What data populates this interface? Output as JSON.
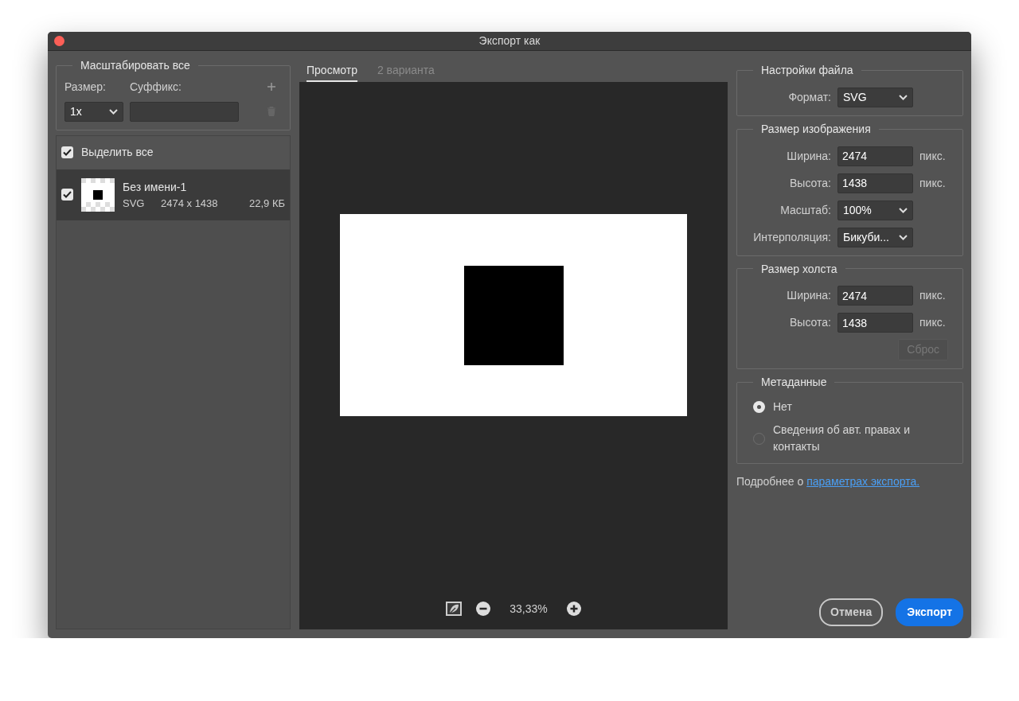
{
  "window": {
    "title": "Экспорт как"
  },
  "scale_all": {
    "title": "Масштабировать все",
    "size_label": "Размер:",
    "suffix_label": "Суффикс:",
    "size_value": "1x"
  },
  "select_all": {
    "label": "Выделить все",
    "checked": true
  },
  "assets": [
    {
      "name": "Без имени-1",
      "format": "SVG",
      "dimensions": "2474 x 1438",
      "file_size": "22,9 КБ",
      "checked": true,
      "selected": true
    }
  ],
  "tabs": [
    {
      "label": "Просмотр",
      "selected": true
    },
    {
      "label": "2 варианта",
      "selected": false
    }
  ],
  "zoom": {
    "reading": "33,33%"
  },
  "file_settings": {
    "title": "Настройки файла",
    "fields": [
      {
        "kind": "select",
        "label": "Формат:",
        "value": "SVG"
      }
    ]
  },
  "image_size": {
    "title": "Размер изображения",
    "fields": [
      {
        "kind": "input",
        "label": "Ширина:",
        "value": "2474",
        "unit": "пикс."
      },
      {
        "kind": "input",
        "label": "Высота:",
        "value": "1438",
        "unit": "пикс."
      },
      {
        "kind": "select",
        "label": "Масштаб:",
        "value": "100%"
      },
      {
        "kind": "select",
        "label": "Интерполяция:",
        "value": "Бикуби..."
      }
    ]
  },
  "canvas_size": {
    "title": "Размер холста",
    "fields": [
      {
        "kind": "input",
        "label": "Ширина:",
        "value": "2474",
        "unit": "пикс."
      },
      {
        "kind": "input",
        "label": "Высота:",
        "value": "1438",
        "unit": "пикс."
      }
    ],
    "reset_button": {
      "label": "Сброс",
      "disabled": true
    }
  },
  "metadata": {
    "title": "Метаданные",
    "options": [
      {
        "label": "Нет",
        "selected": true
      },
      {
        "label": "Сведения об авт. правах и контакты",
        "selected": false
      }
    ]
  },
  "help": {
    "text": "Подробнее о",
    "link": "параметрах экспорта."
  },
  "buttons": [
    {
      "kind": "secondary",
      "label": "Отмена"
    },
    {
      "kind": "primary",
      "label": "Экспорт"
    }
  ]
}
